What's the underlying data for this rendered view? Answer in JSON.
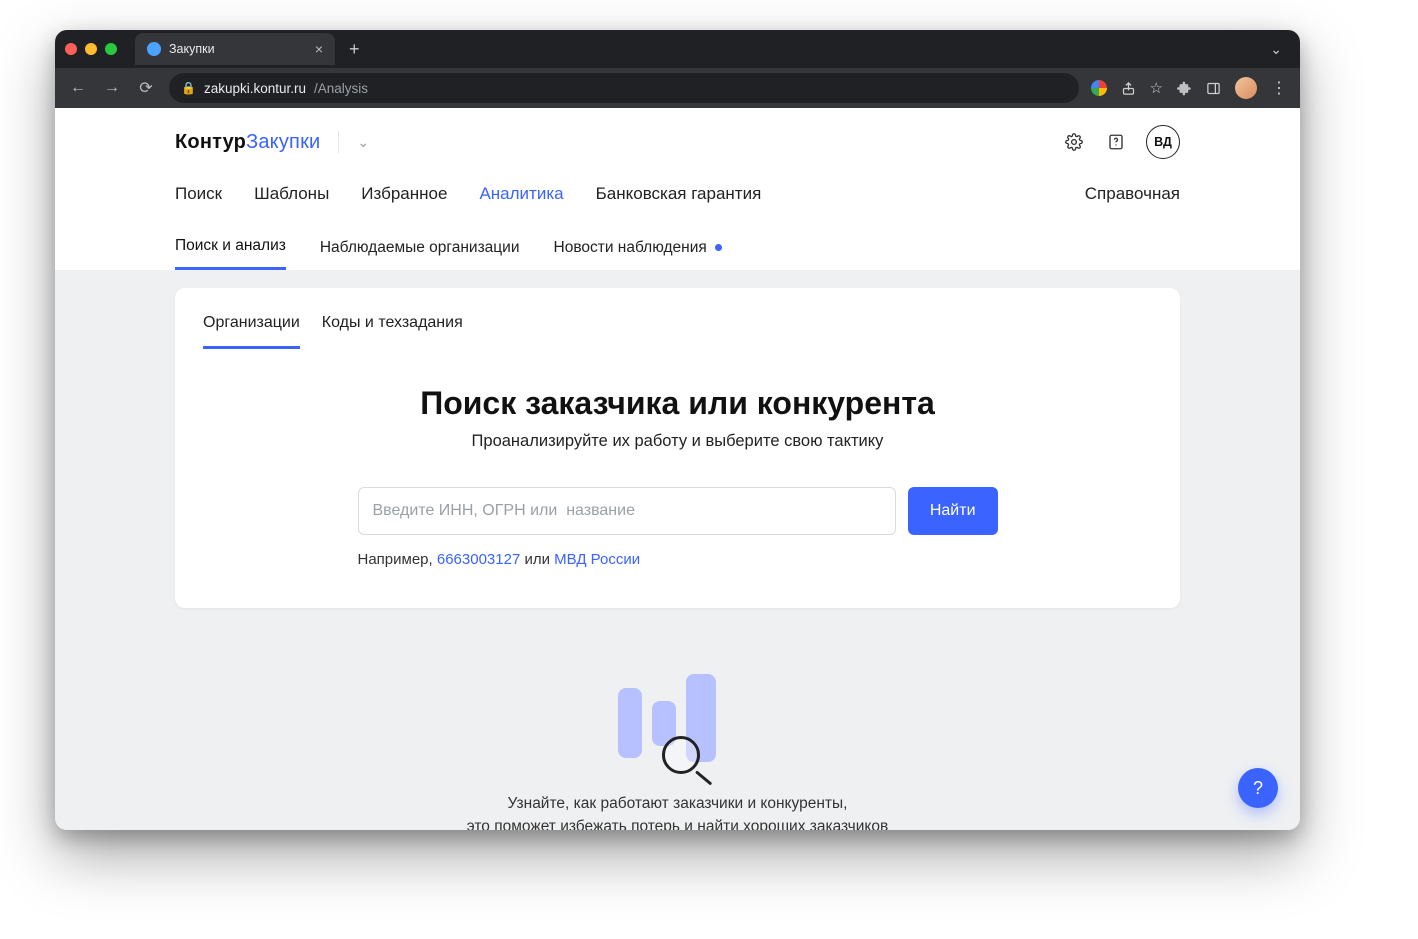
{
  "browser": {
    "tab_title": "Закупки",
    "url_domain": "zakupki.kontur.ru",
    "url_path": "/Analysis"
  },
  "brand": {
    "part1": "Контур",
    "part2": "Закупки"
  },
  "user": {
    "initials": "ВД"
  },
  "mainnav": {
    "search": "Поиск",
    "templates": "Шаблоны",
    "favorites": "Избранное",
    "analytics": "Аналитика",
    "bank_guarantee": "Банковская гарантия",
    "help": "Справочная"
  },
  "subnav": {
    "search_analysis": "Поиск и анализ",
    "watched_orgs": "Наблюдаемые организации",
    "watch_news": "Новости наблюдения"
  },
  "innertabs": {
    "orgs": "Организации",
    "codes": "Коды и техзадания"
  },
  "hero": {
    "title": "Поиск заказчика или конкурента",
    "subtitle": "Проанализируйте их работу и выберите свою тактику"
  },
  "search": {
    "placeholder": "Введите ИНН, ОГРН или  название",
    "button": "Найти"
  },
  "example": {
    "prefix": "Например, ",
    "link1": "6663003127",
    "sep": " или ",
    "link2": "МВД России"
  },
  "caption": {
    "line1": "Узнайте, как работают заказчики и конкуренты,",
    "line2": "это поможет избежать потерь и найти хороших заказчиков"
  },
  "fab": {
    "label": "?"
  }
}
